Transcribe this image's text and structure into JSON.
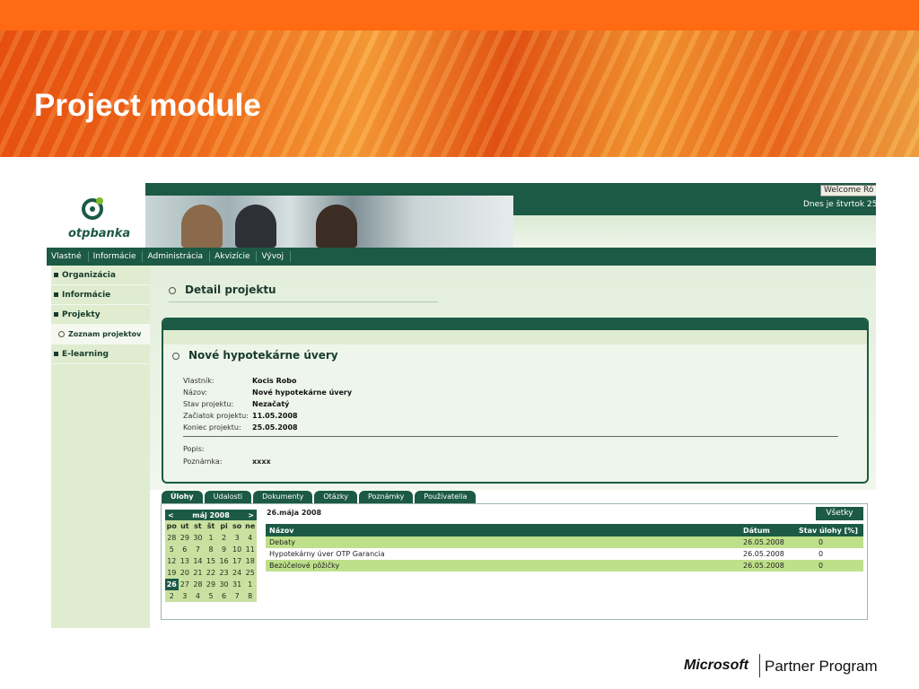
{
  "slide": {
    "title": "Project module",
    "footer_brand": "Microsoft",
    "footer_program": "Partner Program"
  },
  "app": {
    "logo_text": "otpbanka",
    "welcome": "Welcome Ró",
    "date_text": "Dnes je štvrtok 25",
    "topnav": [
      "Vlastné",
      "Informácie",
      "Administrácia",
      "Akvizície",
      "Vývoj"
    ],
    "sidebar": [
      {
        "label": "Organizácia",
        "type": "item"
      },
      {
        "label": "Informácie",
        "type": "item"
      },
      {
        "label": "Projekty",
        "type": "item"
      },
      {
        "label": "Zoznam projektov",
        "type": "sub"
      },
      {
        "label": "E-learning",
        "type": "item"
      }
    ],
    "detail_title": "Detail projektu",
    "project": {
      "title": "Nové hypotekárne úvery",
      "fields": [
        {
          "label": "Vlastník:",
          "value": "Kocis Robo"
        },
        {
          "label": "Názov:",
          "value": "Nové hypotekárne úvery"
        },
        {
          "label": "Stav projektu:",
          "value": "Nezačatý"
        },
        {
          "label": "Začiatok projektu:",
          "value": "11.05.2008"
        },
        {
          "label": "Koniec projektu:",
          "value": "25.05.2008"
        }
      ],
      "fields2": [
        {
          "label": "Popis:",
          "value": ""
        },
        {
          "label": "Poznámka:",
          "value": "xxxx"
        }
      ]
    },
    "tabs": [
      "Úlohy",
      "Udalosti",
      "Dokumenty",
      "Otázky",
      "Poznámky",
      "Používatelia"
    ],
    "calendar": {
      "prev": "<",
      "next": ">",
      "month": "máj 2008",
      "day_names": [
        "po",
        "ut",
        "st",
        "št",
        "pi",
        "so",
        "ne"
      ],
      "days": [
        "28",
        "29",
        "30",
        "1",
        "2",
        "3",
        "4",
        "5",
        "6",
        "7",
        "8",
        "9",
        "10",
        "11",
        "12",
        "13",
        "14",
        "15",
        "16",
        "17",
        "18",
        "19",
        "20",
        "21",
        "22",
        "23",
        "24",
        "25",
        "26",
        "27",
        "28",
        "29",
        "30",
        "31",
        "1",
        "2",
        "3",
        "4",
        "5",
        "6",
        "7",
        "8"
      ],
      "today": "26"
    },
    "tasks": {
      "date": "26.mája 2008",
      "all_button": "Všetky",
      "columns": [
        "Názov",
        "Dátum",
        "Stav úlohy [%]"
      ],
      "rows": [
        [
          "Debaty",
          "26.05.2008",
          "0"
        ],
        [
          "Hypotekárny úver OTP Garancia",
          "26.05.2008",
          "0"
        ],
        [
          "Bezúčelové pôžičky",
          "26.05.2008",
          "0"
        ]
      ]
    },
    "colors": {
      "brand_green": "#1c5a45",
      "light_green": "#bfe08a",
      "slide_orange": "#ff6a13"
    }
  }
}
